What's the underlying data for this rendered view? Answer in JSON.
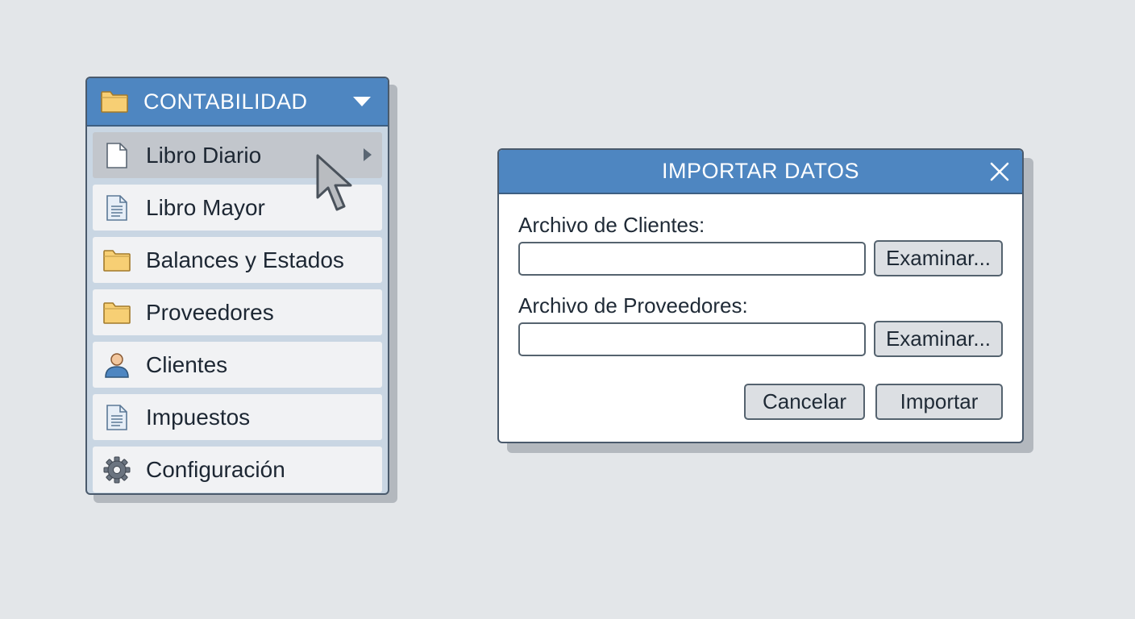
{
  "menu": {
    "header": {
      "label": "CONTABILIDAD",
      "icon": "folder-icon"
    },
    "items": [
      {
        "label": "Libro Diario",
        "icon": "document-icon",
        "active": true
      },
      {
        "label": "Libro Mayor",
        "icon": "text-document-icon"
      },
      {
        "label": "Balances y Estados",
        "icon": "folder-icon"
      },
      {
        "label": "Proveedores",
        "icon": "folder-icon"
      },
      {
        "label": "Clientes",
        "icon": "user-icon"
      },
      {
        "label": "Impuestos",
        "icon": "text-document-icon"
      },
      {
        "label": "Configuración",
        "icon": "gear-icon"
      }
    ]
  },
  "dialog": {
    "title": "IMPORTAR DATOS",
    "clients_label": "Archivo de Clientes:",
    "clients_value": "",
    "suppliers_label": "Archivo de Proveedores:",
    "suppliers_value": "",
    "browse_label": "Examinar...",
    "cancel_label": "Cancelar",
    "import_label": "Importar"
  },
  "colors": {
    "accent": "#4e86c1",
    "folder": "#f7cf74",
    "background": "#e3e6e9"
  }
}
